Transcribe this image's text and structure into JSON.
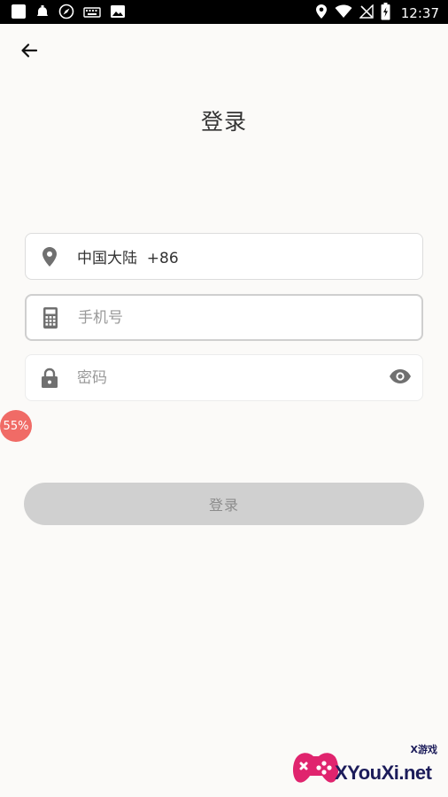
{
  "status_bar": {
    "time": "12:37",
    "left_icons": [
      "app-square-icon",
      "bell-icon",
      "compass-icon",
      "keyboard-icon",
      "image-icon"
    ],
    "right_icons": [
      "location-icon",
      "wifi-icon",
      "no-signal-icon",
      "battery-charging-icon"
    ]
  },
  "header": {
    "back_icon": "arrow-left-icon",
    "title": "登录"
  },
  "form": {
    "region": {
      "icon": "location-pin-icon",
      "value": "中国大陆  +86"
    },
    "phone": {
      "icon": "phone-icon",
      "placeholder": "手机号",
      "value": ""
    },
    "password": {
      "icon": "lock-icon",
      "placeholder": "密码",
      "value": "",
      "toggle_icon": "eye-icon"
    },
    "login_label": "登录"
  },
  "progress_badge": "55%",
  "watermark": {
    "text": "XYouXi.net",
    "subtext": "X游戏"
  },
  "colors": {
    "background": "#fbfaf8",
    "button_disabled": "#d0d0d0",
    "badge": "#f06b66",
    "icon_gray": "#707070"
  }
}
